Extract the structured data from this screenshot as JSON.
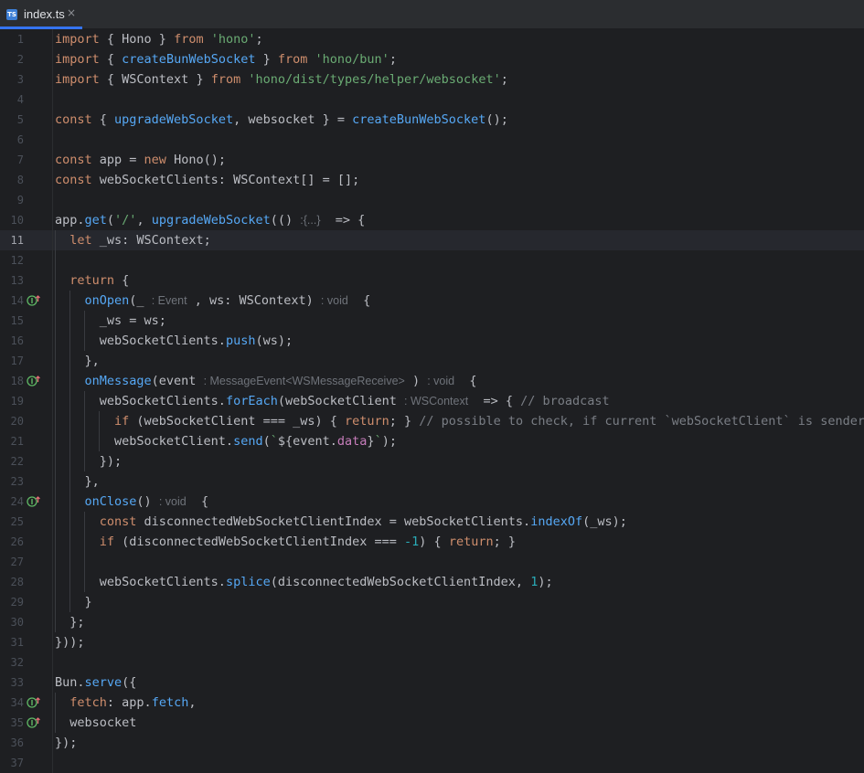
{
  "tab": {
    "icon": "TS",
    "name": "index.ts",
    "close": "×"
  },
  "current_line": 11,
  "lines": [
    {
      "n": "1",
      "g": "",
      "parts": [
        [
          "import",
          "kw"
        ],
        [
          " { Hono } ",
          ""
        ],
        [
          "from",
          "kw"
        ],
        [
          " ",
          ""
        ],
        [
          "'hono'",
          "str"
        ],
        [
          ";",
          ""
        ]
      ]
    },
    {
      "n": "2",
      "g": "",
      "parts": [
        [
          "import",
          "kw"
        ],
        [
          " { ",
          ""
        ],
        [
          "createBunWebSocket",
          "fn"
        ],
        [
          " } ",
          ""
        ],
        [
          "from",
          "kw"
        ],
        [
          " ",
          ""
        ],
        [
          "'hono/bun'",
          "str"
        ],
        [
          ";",
          ""
        ]
      ]
    },
    {
      "n": "3",
      "g": "",
      "parts": [
        [
          "import",
          "kw"
        ],
        [
          " { WSContext } ",
          ""
        ],
        [
          "from",
          "kw"
        ],
        [
          " ",
          ""
        ],
        [
          "'hono/dist/types/helper/websocket'",
          "str"
        ],
        [
          ";",
          ""
        ]
      ]
    },
    {
      "n": "4",
      "g": "",
      "parts": []
    },
    {
      "n": "5",
      "g": "",
      "parts": [
        [
          "const",
          "kw"
        ],
        [
          " { ",
          ""
        ],
        [
          "upgradeWebSocket",
          "fn"
        ],
        [
          ", websocket } = ",
          ""
        ],
        [
          "createBunWebSocket",
          "fn"
        ],
        [
          "();",
          ""
        ]
      ]
    },
    {
      "n": "6",
      "g": "",
      "parts": []
    },
    {
      "n": "7",
      "g": "",
      "parts": [
        [
          "const",
          "kw"
        ],
        [
          " app = ",
          ""
        ],
        [
          "new",
          "kw"
        ],
        [
          " Hono();",
          ""
        ]
      ]
    },
    {
      "n": "8",
      "g": "",
      "parts": [
        [
          "const",
          "kw"
        ],
        [
          " webSocketClients: WSContext[] = [];",
          ""
        ]
      ]
    },
    {
      "n": "9",
      "g": "",
      "parts": []
    },
    {
      "n": "10",
      "g": "",
      "parts": [
        [
          "app.",
          ""
        ],
        [
          "get",
          "fn"
        ],
        [
          "(",
          ""
        ],
        [
          "'/'",
          "str"
        ],
        [
          ", ",
          ""
        ],
        [
          "upgradeWebSocket",
          "fn"
        ],
        [
          "(() ",
          ""
        ],
        [
          ":{...}",
          "hint"
        ],
        [
          "  => {",
          ""
        ]
      ]
    },
    {
      "n": "11",
      "g": "",
      "parts": [
        [
          "  ",
          ""
        ],
        [
          "let",
          "kw"
        ],
        [
          " _ws: WSContext;",
          ""
        ]
      ]
    },
    {
      "n": "12",
      "g": "",
      "parts": []
    },
    {
      "n": "13",
      "g": "",
      "parts": [
        [
          "  ",
          ""
        ],
        [
          "return",
          "kw"
        ],
        [
          " {",
          ""
        ]
      ]
    },
    {
      "n": "14",
      "g": "impl",
      "parts": [
        [
          "    ",
          ""
        ],
        [
          "onOpen",
          "fn"
        ],
        [
          "(_ ",
          ""
        ],
        [
          ": Event",
          "hint"
        ],
        [
          " , ws: WSContext) ",
          ""
        ],
        [
          ": void",
          "hint"
        ],
        [
          "  {",
          ""
        ]
      ]
    },
    {
      "n": "15",
      "g": "",
      "parts": [
        [
          "      _ws = ws;",
          ""
        ]
      ]
    },
    {
      "n": "16",
      "g": "",
      "parts": [
        [
          "      webSocketClients.",
          ""
        ],
        [
          "push",
          "fn"
        ],
        [
          "(ws);",
          ""
        ]
      ]
    },
    {
      "n": "17",
      "g": "",
      "parts": [
        [
          "    },",
          ""
        ]
      ]
    },
    {
      "n": "18",
      "g": "impl",
      "parts": [
        [
          "    ",
          ""
        ],
        [
          "onMessage",
          "fn"
        ],
        [
          "(event ",
          ""
        ],
        [
          ": MessageEvent<WSMessageReceive>",
          "hint"
        ],
        [
          " ) ",
          ""
        ],
        [
          ": void",
          "hint"
        ],
        [
          "  {",
          ""
        ]
      ]
    },
    {
      "n": "19",
      "g": "",
      "parts": [
        [
          "      webSocketClients.",
          ""
        ],
        [
          "forEach",
          "fn"
        ],
        [
          "(webSocketClient ",
          ""
        ],
        [
          ": WSContext",
          "hint"
        ],
        [
          "  => { ",
          ""
        ],
        [
          "// broadcast",
          "cm"
        ]
      ]
    },
    {
      "n": "20",
      "g": "",
      "parts": [
        [
          "        ",
          ""
        ],
        [
          "if",
          "kw"
        ],
        [
          " (webSocketClient === _ws) { ",
          ""
        ],
        [
          "return",
          "kw"
        ],
        [
          "; } ",
          ""
        ],
        [
          "// possible to check, if current `webSocketClient` is sender",
          "cm"
        ]
      ]
    },
    {
      "n": "21",
      "g": "",
      "parts": [
        [
          "        webSocketClient.",
          ""
        ],
        [
          "send",
          "fn"
        ],
        [
          "(",
          ""
        ],
        [
          "`",
          "str"
        ],
        [
          "${event.",
          ""
        ],
        [
          "data",
          "prop"
        ],
        [
          "}",
          ""
        ],
        [
          "`",
          "str"
        ],
        [
          ");",
          ""
        ]
      ]
    },
    {
      "n": "22",
      "g": "",
      "parts": [
        [
          "      });",
          ""
        ]
      ]
    },
    {
      "n": "23",
      "g": "",
      "parts": [
        [
          "    },",
          ""
        ]
      ]
    },
    {
      "n": "24",
      "g": "impl",
      "parts": [
        [
          "    ",
          ""
        ],
        [
          "onClose",
          "fn"
        ],
        [
          "() ",
          ""
        ],
        [
          ": void",
          "hint"
        ],
        [
          "  {",
          ""
        ]
      ]
    },
    {
      "n": "25",
      "g": "",
      "parts": [
        [
          "      ",
          ""
        ],
        [
          "const",
          "kw"
        ],
        [
          " disconnectedWebSocketClientIndex = webSocketClients.",
          ""
        ],
        [
          "indexOf",
          "fn"
        ],
        [
          "(_ws);",
          ""
        ]
      ]
    },
    {
      "n": "26",
      "g": "",
      "parts": [
        [
          "      ",
          ""
        ],
        [
          "if",
          "kw"
        ],
        [
          " (disconnectedWebSocketClientIndex === ",
          ""
        ],
        [
          "-1",
          "num"
        ],
        [
          ") { ",
          ""
        ],
        [
          "return",
          "kw"
        ],
        [
          "; }",
          ""
        ]
      ]
    },
    {
      "n": "27",
      "g": "",
      "parts": []
    },
    {
      "n": "28",
      "g": "",
      "parts": [
        [
          "      webSocketClients.",
          ""
        ],
        [
          "splice",
          "fn"
        ],
        [
          "(disconnectedWebSocketClientIndex, ",
          ""
        ],
        [
          "1",
          "num"
        ],
        [
          ");",
          ""
        ]
      ]
    },
    {
      "n": "29",
      "g": "",
      "parts": [
        [
          "    }",
          ""
        ]
      ]
    },
    {
      "n": "30",
      "g": "",
      "parts": [
        [
          "  };",
          ""
        ]
      ]
    },
    {
      "n": "31",
      "g": "",
      "parts": [
        [
          "}));",
          ""
        ]
      ]
    },
    {
      "n": "32",
      "g": "",
      "parts": []
    },
    {
      "n": "33",
      "g": "",
      "parts": [
        [
          "Bun.",
          ""
        ],
        [
          "serve",
          "fn"
        ],
        [
          "({",
          ""
        ]
      ]
    },
    {
      "n": "34",
      "g": "impl",
      "parts": [
        [
          "  ",
          ""
        ],
        [
          "fetch",
          "kw"
        ],
        [
          ": app.",
          ""
        ],
        [
          "fetch",
          "fn"
        ],
        [
          ",",
          ""
        ]
      ]
    },
    {
      "n": "35",
      "g": "impl",
      "parts": [
        [
          "  websocket",
          ""
        ]
      ]
    },
    {
      "n": "36",
      "g": "",
      "parts": [
        [
          "});",
          ""
        ]
      ]
    },
    {
      "n": "37",
      "g": "",
      "parts": []
    }
  ]
}
